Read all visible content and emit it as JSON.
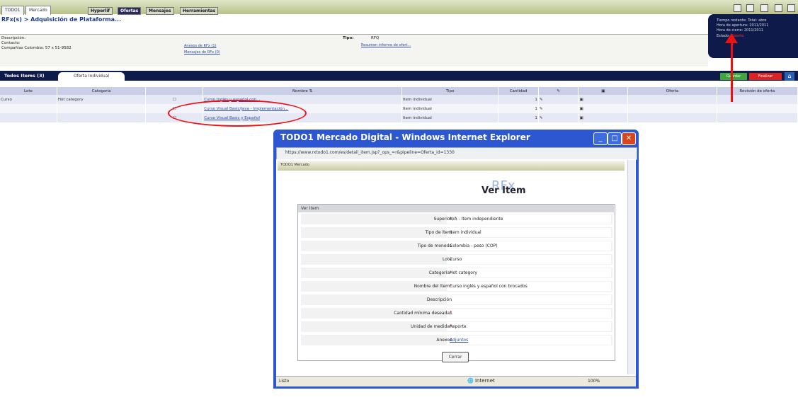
{
  "app": {
    "tabs": [
      "TODO1",
      "Mercado"
    ],
    "nav": [
      "Hyperlif",
      "Ofertas",
      "Mensajes",
      "Herramientas"
    ],
    "breadcrumb": "RFx(s) > Adquisición de Plataforma..."
  },
  "info_panel": {
    "descripcion_label": "Descripción:",
    "contacto_label": "Contacto:",
    "contacto_value": "Compañías Colombia: 57 x 51-9582",
    "tipo_label": "Tipo:",
    "tipo_value": "RFQ",
    "link_anexos": "Anexos de RFx (1)",
    "link_mensajes": "Mensajes de RFx (0)",
    "link_resumen": "Resumen informe de ofert..."
  },
  "status_panel": {
    "line1": "Tiempo restante: Total: abre",
    "line2": "Hora de apertura: 2011/2011",
    "line3": "Hora de cierre: 2011/2011",
    "estado_label": "Estado:",
    "estado_value": "Abierto"
  },
  "tab_strip": {
    "tab_items": "Todos Items (3)",
    "tab_oferta": "Oferta Individual",
    "btn_guardar": "Guardar",
    "btn_finalizar": "Finalizar",
    "home_icon": "home-icon"
  },
  "table": {
    "columns": [
      "Lote",
      "Categoría",
      "",
      "Nombre",
      "Tipo",
      "Cantidad",
      "",
      "",
      "Oferta",
      "Revisión de oferta"
    ],
    "rows": [
      {
        "lote": "Curso",
        "categoria": "Hot category",
        "nombre": "Curso Inglés y español con..."
      },
      {
        "lote": "",
        "categoria": "",
        "nombre": "Curso Visual Basic/Java - Implementación..."
      },
      {
        "lote": "",
        "categoria": "",
        "nombre": "Curso Visual Basic y Español"
      }
    ],
    "tipo_value": "Item individual",
    "cantidad_value": "1"
  },
  "popup": {
    "title": "TODO1 Mercado Digital - Windows Internet Explorer",
    "address": "https://www.rxtodo1.com/es/detail_item.jsp?_ops_=r&pipeline=Oferta_id=1330",
    "inner_tabs": "TODO1 Mercado",
    "logo": "RFx",
    "heading": "Ver Item",
    "section_label": "Ver Item",
    "fields": [
      {
        "label": "Superior",
        "value": "N/A - Item independiente",
        "req": ""
      },
      {
        "label": "Tipo de ítem",
        "value": "Item individual",
        "req": ""
      },
      {
        "label": "Tipo de moneda",
        "value": "Colombia - peso (COP)",
        "req": ""
      },
      {
        "label": "Lote",
        "value": "Curso",
        "req": ""
      },
      {
        "label": "Categoría",
        "value": "Hot category",
        "req": "*"
      },
      {
        "label": "Nombre del ítem",
        "value": "Curso inglés y español con brocados",
        "req": "*"
      },
      {
        "label": "Descripción",
        "value": "",
        "req": ""
      },
      {
        "label": "Cantidad mínima deseada",
        "value": "1",
        "req": "*"
      },
      {
        "label": "Unidad de medida",
        "value": "Reporte",
        "req": "*"
      },
      {
        "label": "Anexos",
        "value": "Adjuntos",
        "req": ""
      }
    ],
    "close_label": "Cerrar",
    "status_left": "Listo",
    "status_zone": "Internet",
    "status_zoom": "100%"
  }
}
